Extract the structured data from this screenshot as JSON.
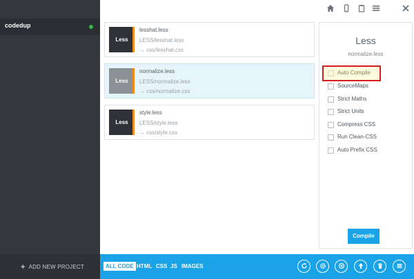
{
  "sidebar": {
    "project_name": "codedup",
    "add_project_label": "ADD NEW PROJECT",
    "add_project_icon": "+"
  },
  "toolbar": {
    "icons": [
      "home-icon",
      "mobile-icon",
      "clipboard-icon",
      "menu-icon",
      "close-icon"
    ]
  },
  "files": [
    {
      "badge": "Less",
      "name": "lesshat.less",
      "src": "LESS/lesshat.less",
      "out": "→ css/lesshat.css",
      "selected": false
    },
    {
      "badge": "Less",
      "name": "normalize.less",
      "src": "LESS/normalize.less",
      "out": "→ css/normalize.css",
      "selected": true
    },
    {
      "badge": "Less",
      "name": "style.less",
      "src": "LESS/style.less",
      "out": "→ css/style.css",
      "selected": false
    }
  ],
  "panel": {
    "title": "Less",
    "subtitle": "normalize.less",
    "options": [
      "Auto Compile",
      "SourceMaps",
      "Strict Maths",
      "Strict Units",
      "Compress CSS",
      "Run Clean-CSS",
      "Auto Prefix CSS"
    ],
    "compile_label": "Compile"
  },
  "bottom": {
    "filters": [
      "ALL CODE",
      "HTML",
      "CSS",
      "JS",
      "IMAGES"
    ],
    "icons": [
      "refresh-icon",
      "settings-icon",
      "preview-icon",
      "upload-icon",
      "trash-icon",
      "list-icon"
    ]
  },
  "colors": {
    "accent": "#1aa3e6",
    "sidebar": "#34383e",
    "less_orange": "#f28b1e",
    "status_green": "#39b54a",
    "highlight_red": "#d61b1b"
  }
}
